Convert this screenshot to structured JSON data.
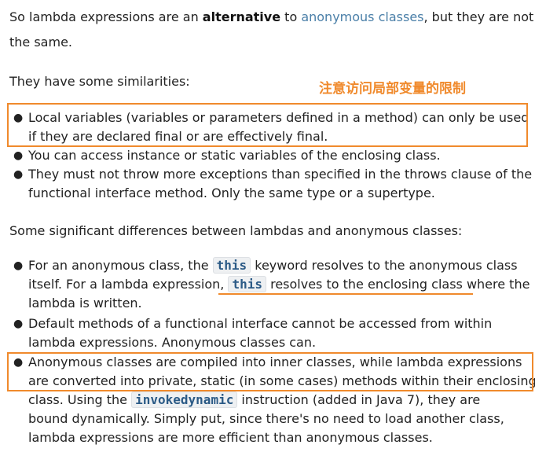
{
  "intro": {
    "before": "So lambda expressions are an ",
    "bold": "alternative",
    "middle": " to ",
    "link": "anonymous classes",
    "after_line1": ", but they are not",
    "line2": "the same."
  },
  "similarities_heading": "They have some similarities:",
  "annotation": "注意访问局部变量的限制",
  "similarities": [
    {
      "l1": "Local variables (variables or parameters defined in a method) can only be used",
      "l2": "if they are declared final or are effectively final."
    },
    {
      "l1": "You can access instance or static variables of the enclosing class."
    },
    {
      "l1": "They must not throw more exceptions than specified in the throws clause of the",
      "l2": "functional interface method. Only the same type or a supertype."
    }
  ],
  "differences_heading": "Some significant differences between lambdas and anonymous classes:",
  "differences": {
    "item1": {
      "l1a": "For an anonymous class, the ",
      "code1": "this",
      "l1b": " keyword resolves to the anonymous class",
      "l2a": "itself. For a lambda expression, ",
      "code2": "this",
      "l2b": " resolves to the enclosing class where the",
      "l3": "lambda is written."
    },
    "item2": {
      "l1": "Default methods of a functional interface cannot be accessed from within",
      "l2": "lambda expressions. Anonymous classes can."
    },
    "item3": {
      "l1": "Anonymous classes are compiled into inner classes, while lambda expressions",
      "l2": "are converted into private, static (in some cases) methods within their enclosing",
      "l3a": "class. Using the ",
      "code": "invokedynamic",
      "l3b": " instruction (added in Java 7), they are",
      "l4": "bound dynamically. Simply put, since there's no need to load another class,",
      "l5": "lambda expressions are more efficient than anonymous classes."
    }
  },
  "colors": {
    "highlight": "#f08a2c",
    "link": "#4a7fa8",
    "code": "#2b5a86"
  }
}
